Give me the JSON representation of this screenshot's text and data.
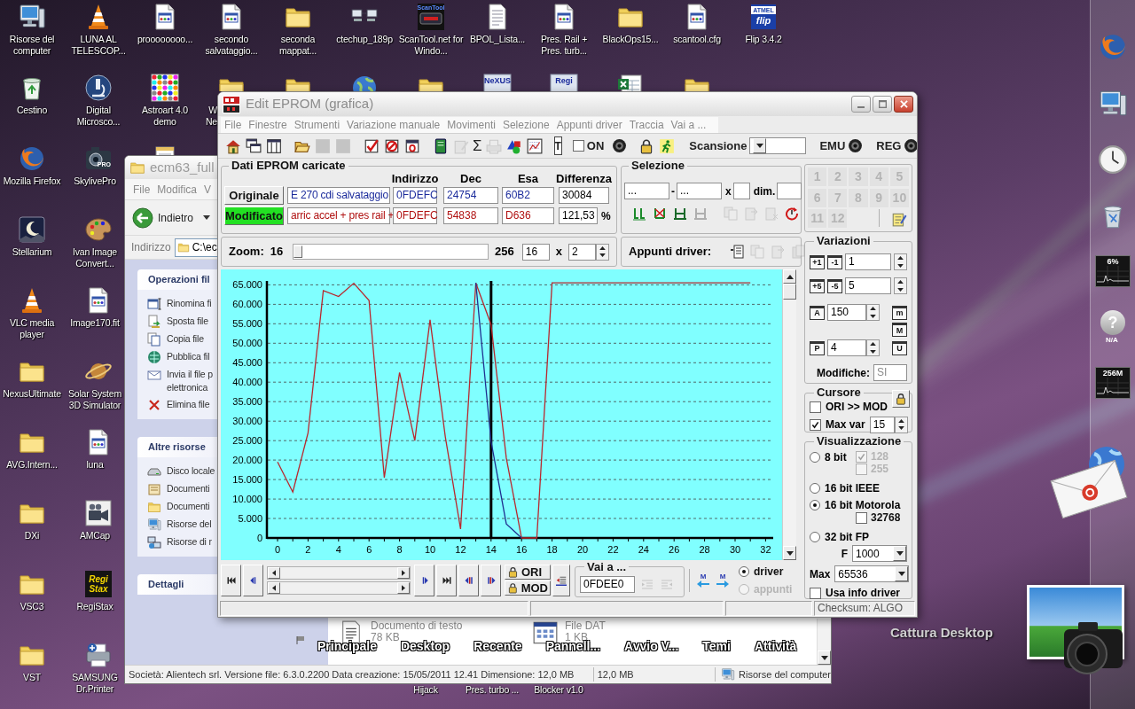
{
  "desktop": {
    "icon_columns": [
      [
        {
          "kind": "computer",
          "label": "Risorse del computer"
        },
        {
          "kind": "recycle-bin",
          "label": "Cestino"
        },
        {
          "kind": "browser",
          "label": "Mozilla Firefox"
        },
        {
          "kind": "moon",
          "label": "Stellarium"
        },
        {
          "kind": "cone",
          "label": "VLC media player"
        },
        {
          "kind": "folder",
          "label": "NexusUltimate"
        },
        {
          "kind": "folder",
          "label": "AVG.Intern..."
        },
        {
          "kind": "folder",
          "label": "DXi"
        },
        {
          "kind": "folder",
          "label": "VSC3"
        },
        {
          "kind": "folder",
          "label": "VST"
        }
      ],
      [
        {
          "kind": "cone",
          "label": "LUNA AL TELESCOP..."
        },
        {
          "kind": "microscope",
          "label": "Digital Microsco..."
        },
        {
          "kind": "camera",
          "label": "SkylivePro",
          "icon_text": [
            "PRO"
          ]
        },
        {
          "kind": "palette",
          "label": "Ivan Image Convert..."
        },
        {
          "kind": "file",
          "label": "Image170.fit"
        },
        {
          "kind": "planet",
          "label": "Solar System 3D Simulator"
        },
        {
          "kind": "file",
          "label": "luna"
        },
        {
          "kind": "video-camera",
          "label": "AMCap"
        },
        {
          "kind": "dark-tile",
          "label": "RegiStax",
          "icon_text": [
            "Regi",
            "Stax"
          ]
        },
        {
          "kind": "printer",
          "label": "SAMSUNG Dr.Printer"
        }
      ],
      [
        {
          "kind": "file",
          "label": "proooooooo..."
        },
        {
          "kind": "color-grid",
          "label": "Astroart 4.0 demo"
        },
        {
          "kind": "notepad"
        }
      ],
      [
        {
          "kind": "file",
          "label": "secondo salvataggio..."
        },
        {
          "kind": "folder",
          "label": "W\nNe"
        }
      ],
      [
        {
          "kind": "folder",
          "label": "seconda mappat..."
        },
        {
          "kind": "folder"
        }
      ],
      [
        {
          "kind": "network",
          "label": "ctechup_189p"
        },
        {
          "kind": "globe"
        }
      ],
      [
        {
          "kind": "scan-tile",
          "label": "ScanTool.net for Windo...",
          "icon_text": [
            "ScanTool"
          ]
        },
        {
          "kind": "folder"
        }
      ],
      [
        {
          "kind": "text-page",
          "label": "BPOL_Lista..."
        },
        {
          "kind": "light-tile",
          "icon_text": [
            "NeXUS"
          ]
        }
      ],
      [
        {
          "kind": "file",
          "label": "Pres. Rail + Pres. turb..."
        },
        {
          "kind": "light-tile",
          "icon_text": [
            "Regi"
          ]
        }
      ],
      [
        {
          "kind": "folder",
          "label": "BlackOps15..."
        },
        {
          "kind": "spreadsheet"
        }
      ],
      [
        {
          "kind": "file",
          "label": "scantool.cfg"
        },
        {
          "kind": "folder"
        }
      ],
      [
        {
          "kind": "blue-tile",
          "label": "Flip 3.4.2",
          "icon_text": [
            "ATMEL",
            "flip"
          ]
        }
      ]
    ],
    "labels_below_window": [
      "Hijack",
      "Pres. turbo ...",
      "Blocker v1.0"
    ]
  },
  "dock": {
    "items": [
      {
        "kind": "browser"
      },
      {
        "kind": "computer"
      },
      {
        "kind": "clock"
      },
      {
        "kind": "trash"
      },
      {
        "kind": "meter",
        "label": "6%"
      },
      {
        "kind": "badge",
        "symbol": "?",
        "label": "N/A"
      },
      {
        "kind": "meter",
        "label": "256M"
      }
    ]
  },
  "widgets": [
    {
      "kind": "mail"
    },
    {
      "kind": "capture",
      "label": "Cattura Desktop"
    }
  ],
  "explorer_window": {
    "title": "ecm63_full",
    "menu": [
      "File",
      "Modifica",
      "V"
    ],
    "back_button": "Indietro",
    "address_label": "Indirizzo",
    "address_value": "C:\\ec",
    "task_groups": [
      {
        "title": "Operazioni fil",
        "items": [
          {
            "kind": "rename",
            "label": "Rinomina fi"
          },
          {
            "kind": "move",
            "label": "Sposta file"
          },
          {
            "kind": "copy",
            "label": "Copia file"
          },
          {
            "kind": "publish",
            "label": "Pubblica fil"
          },
          {
            "kind": "mail",
            "label": "Invia il file p\nelettronica"
          },
          {
            "kind": "delete",
            "label": "Elimina file"
          }
        ]
      },
      {
        "title": "Altre risorse",
        "items": [
          {
            "kind": "disk",
            "label": "Disco locale"
          },
          {
            "kind": "documents",
            "label": "Documenti"
          },
          {
            "kind": "folder",
            "label": "Documenti"
          },
          {
            "kind": "computer",
            "label": "Risorse del"
          },
          {
            "kind": "network",
            "label": "Risorse di r"
          }
        ]
      },
      {
        "title": "Dettagli"
      }
    ],
    "files": [
      {
        "kind": "text",
        "type": "Documento di testo",
        "size": "78 KB"
      },
      {
        "kind": "dat",
        "type": "File DAT",
        "size": "1 KB"
      }
    ],
    "launcher": [
      "Principale",
      "Desktop",
      "Recente",
      "Pannell...",
      "Avvio V...",
      "Temi",
      "Attività"
    ],
    "status_bar": [
      "Società: Alientech srl. Versione file: 6.3.0.2200 Data creazione: 15/05/2011 12.41 Dimensione: 12,0 MB",
      "12,0 MB",
      "Risorse del computer"
    ]
  },
  "eprom_window": {
    "title": "Edit EPROM (grafica)",
    "menu": [
      "File",
      "Finestre",
      "Strumenti",
      "Variazione manuale",
      "Movimenti",
      "Selezione",
      "Appunti driver",
      "Traccia",
      "Vai a ..."
    ],
    "toolbar": [
      {
        "kind": "home",
        "disabled": false
      },
      {
        "kind": "windows",
        "disabled": false
      },
      {
        "kind": "panel",
        "disabled": false
      },
      {
        "kind": "separator"
      },
      {
        "kind": "open",
        "disabled": false
      },
      {
        "kind": "blank",
        "disabled": true
      },
      {
        "kind": "blank",
        "disabled": true
      },
      {
        "kind": "separator"
      },
      {
        "kind": "check",
        "disabled": false
      },
      {
        "kind": "forbid",
        "disabled": false
      },
      {
        "kind": "zero",
        "disabled": false
      },
      {
        "kind": "separator"
      },
      {
        "kind": "book",
        "disabled": false
      },
      {
        "kind": "edit",
        "disabled": true
      },
      {
        "kind": "glyph",
        "text": "Σ",
        "disabled": false
      },
      {
        "kind": "printer",
        "disabled": true
      },
      {
        "kind": "shapes",
        "disabled": false
      },
      {
        "kind": "chart",
        "disabled": false
      },
      {
        "kind": "separator"
      },
      {
        "kind": "glyph-box",
        "text": "T",
        "disabled": false
      },
      {
        "kind": "separator"
      },
      {
        "kind": "checkbox",
        "label": "ON",
        "checked": false
      },
      {
        "kind": "knob"
      },
      {
        "kind": "separator"
      },
      {
        "kind": "lock",
        "disabled": false
      },
      {
        "kind": "runner",
        "disabled": false
      },
      {
        "kind": "separator"
      },
      {
        "kind": "dropdown",
        "label": "Scansione"
      },
      {
        "kind": "separator"
      },
      {
        "kind": "knob",
        "label": "EMU"
      },
      {
        "kind": "separator"
      },
      {
        "kind": "knob",
        "label": "REG"
      }
    ],
    "loaded_data": {
      "title": "Dati EPROM caricate",
      "columns": [
        "Indirizzo",
        "Dec",
        "Esa",
        "Differenza"
      ],
      "rows": [
        {
          "kind": "original",
          "button": "Originale",
          "name": "E 270 cdi salvataggio",
          "address": "0FDEFC",
          "dec": "24754",
          "hex": "60B2",
          "difference": "30084"
        },
        {
          "kind": "modified",
          "button": "Modificato",
          "name": "arric accel + pres rail +",
          "address": "0FDEFC",
          "dec": "54838",
          "hex": "D636",
          "difference": "121,53",
          "unit": "%"
        }
      ]
    },
    "selection": {
      "title": "Selezione",
      "from": "...",
      "separator": "-",
      "to": "...",
      "times_label": "x",
      "dim_label": "dim.",
      "tools": [
        {
          "kind": "range-start",
          "disabled": false
        },
        {
          "kind": "range-clear",
          "disabled": false
        },
        {
          "kind": "range",
          "disabled": false
        },
        {
          "kind": "range",
          "disabled": true
        },
        {
          "kind": "separator"
        },
        {
          "kind": "copy",
          "disabled": true
        },
        {
          "kind": "paste",
          "disabled": true
        },
        {
          "kind": "doc-x",
          "disabled": true
        },
        {
          "kind": "reset",
          "disabled": false
        }
      ]
    },
    "zoom": {
      "label": "Zoom:",
      "min": "16",
      "max": "256",
      "level": 0,
      "value": "16",
      "times": "x",
      "factor": "2"
    },
    "clipboard": {
      "label": "Appunti driver:",
      "tools": [
        {
          "kind": "d-doc",
          "disabled": false
        },
        {
          "kind": "copy",
          "disabled": true
        },
        {
          "kind": "paste",
          "disabled": true
        },
        {
          "kind": "stack",
          "disabled": true
        }
      ]
    },
    "chart_data": {
      "type": "line",
      "x": [
        0,
        1,
        2,
        3,
        4,
        5,
        6,
        7,
        8,
        9,
        10,
        11,
        12,
        13,
        14,
        15,
        16,
        17,
        18,
        19,
        20,
        21,
        22,
        23,
        24,
        25,
        26,
        27,
        28,
        29,
        30,
        31
      ],
      "series": [
        {
          "color": "#b8282e",
          "values": [
            19.5,
            11.8,
            27,
            63.5,
            62,
            65.4,
            61,
            15.5,
            42.5,
            25,
            56,
            26,
            2.3,
            65.5,
            54.8,
            20.5,
            0,
            0,
            65.5,
            65.5,
            65.5,
            65.5,
            65.5,
            65.5,
            65.5,
            65.5,
            65.5,
            65.5,
            65.5,
            65.5,
            65.5,
            65.5
          ]
        },
        {
          "color": "#1f2f8f",
          "values": [
            null,
            null,
            null,
            null,
            null,
            null,
            null,
            null,
            null,
            null,
            null,
            null,
            null,
            65.5,
            24.8,
            3.6,
            0,
            null,
            null,
            null,
            null,
            null,
            null,
            null,
            null,
            null,
            null,
            null,
            null,
            null,
            null,
            null
          ]
        }
      ],
      "xlim": [
        -0.7,
        32.5
      ],
      "ylim": [
        0,
        66
      ],
      "grid": true,
      "xticks": [
        0,
        2,
        4,
        6,
        8,
        10,
        12,
        14,
        16,
        18,
        20,
        22,
        24,
        26,
        28,
        30,
        32
      ],
      "yticks": [
        {
          "value": 0,
          "label": "0"
        },
        {
          "value": 5,
          "label": "5.000"
        },
        {
          "value": 10,
          "label": "10.000"
        },
        {
          "value": 15,
          "label": "15.000"
        },
        {
          "value": 20,
          "label": "20.000"
        },
        {
          "value": 25,
          "label": "25.000"
        },
        {
          "value": 30,
          "label": "30.000"
        },
        {
          "value": 35,
          "label": "35.000"
        },
        {
          "value": 40,
          "label": "40.000"
        },
        {
          "value": 45,
          "label": "45.000"
        },
        {
          "value": 50,
          "label": "50.000"
        },
        {
          "value": 55,
          "label": "55.000"
        },
        {
          "value": 60,
          "label": "60.000"
        },
        {
          "value": 65,
          "label": "65.000"
        }
      ],
      "ref_lines": [
        {
          "axis": "x",
          "value": 14
        }
      ]
    },
    "navigation": {
      "left_buttons": [
        {
          "kind": "first"
        },
        {
          "kind": "prev"
        }
      ],
      "right_buttons": [
        {
          "kind": "next"
        },
        {
          "kind": "last"
        },
        {
          "kind": "prev-block"
        },
        {
          "kind": "next-block"
        }
      ],
      "lock_buttons": [
        "ORI",
        "MOD"
      ],
      "side_button": {
        "kind": "list-arrow"
      },
      "goto": {
        "title": "Vai a ...",
        "value": "0FDEE0",
        "tools": [
          {
            "kind": "indent",
            "disabled": true
          },
          {
            "kind": "outdent",
            "disabled": true
          }
        ]
      },
      "markers": [
        {
          "kind": "left",
          "label": "M"
        },
        {
          "kind": "right",
          "label": "M"
        }
      ],
      "sources": [
        {
          "label": "driver",
          "selected": true,
          "disabled": false
        },
        {
          "label": "appunti",
          "selected": false,
          "disabled": true
        }
      ]
    },
    "slots": {
      "items": [
        {
          "label": "1",
          "disabled": true
        },
        {
          "label": "2",
          "disabled": true
        },
        {
          "label": "3",
          "disabled": true
        },
        {
          "label": "4",
          "disabled": true
        },
        {
          "label": "5",
          "disabled": true
        },
        {
          "label": "6",
          "disabled": true
        },
        {
          "label": "7",
          "disabled": true
        },
        {
          "label": "8",
          "disabled": true
        },
        {
          "label": "9",
          "disabled": true
        },
        {
          "label": "10",
          "disabled": true
        },
        {
          "label": "11",
          "disabled": true
        },
        {
          "label": "12",
          "disabled": true
        }
      ],
      "tools": [
        {
          "kind": "note",
          "disabled": false
        }
      ]
    },
    "variations": {
      "title": "Variazioni",
      "rows": [
        {
          "kind": "pair",
          "buttons": [
            "+1",
            "-1"
          ],
          "value": "1"
        },
        {
          "kind": "pair",
          "buttons": [
            "+5",
            "-5"
          ],
          "value": "5"
        },
        {
          "kind": "single",
          "button": "A",
          "value": "150",
          "side_button": "m"
        },
        {
          "kind": "side",
          "side_button": "M"
        },
        {
          "kind": "single",
          "button": "P",
          "value": "4",
          "side_button": "U"
        }
      ],
      "changes": {
        "label": "Modifiche:",
        "value": "SI",
        "disabled": true
      }
    },
    "cursor": {
      "title": "Cursore",
      "options": [
        {
          "label": "ORI >> MOD",
          "checked": false
        },
        {
          "label": "Max var",
          "checked": true,
          "value": "15"
        }
      ]
    },
    "display": {
      "title": "Visualizzazione",
      "modes": [
        {
          "label": "8 bit",
          "selected": false,
          "options": [
            {
              "label": "128",
              "checked": true,
              "disabled": true
            },
            {
              "label": "255",
              "checked": false,
              "disabled": true
            }
          ]
        },
        {
          "label": "16 bit IEEE",
          "selected": false
        },
        {
          "label": "16 bit Motorola",
          "selected": true,
          "options": [
            {
              "label": "32768",
              "checked": false,
              "disabled": false
            }
          ]
        },
        {
          "label": "32 bit FP",
          "selected": false,
          "field": {
            "label": "F",
            "value": "1000"
          }
        }
      ],
      "max": {
        "label": "Max",
        "value": "65536"
      },
      "use_driver": {
        "label": "Usa info driver",
        "checked": false
      }
    },
    "status_bar": [
      "Checksum: ALGO"
    ]
  }
}
